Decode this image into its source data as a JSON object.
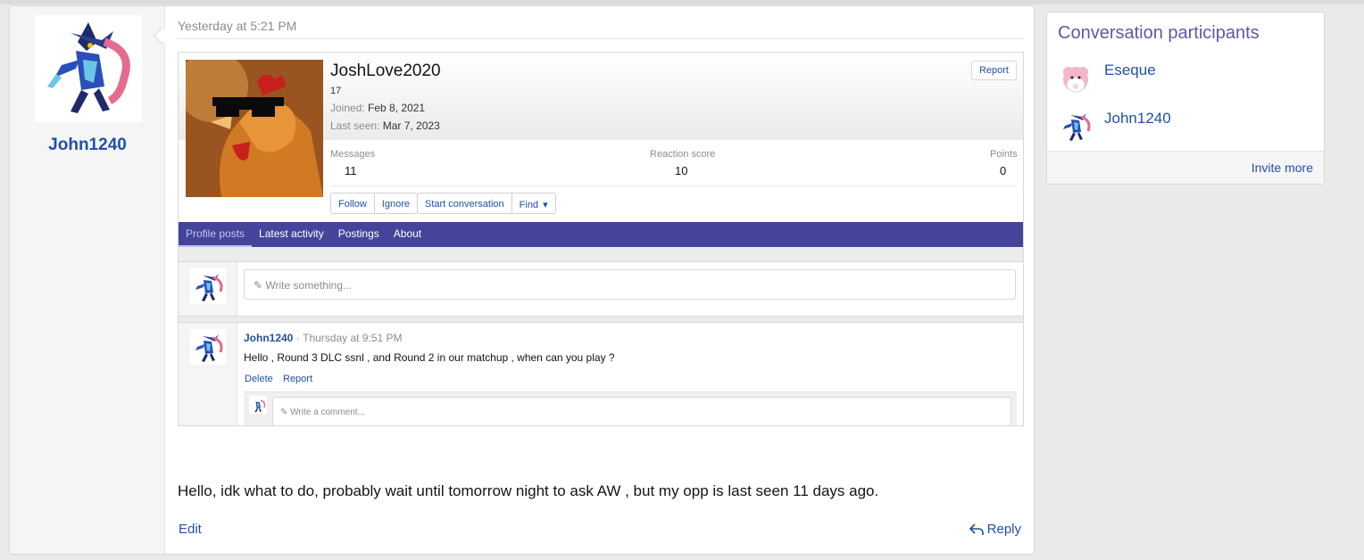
{
  "message": {
    "username": "John1240",
    "date": "Yesterday at 5:21 PM",
    "body": "Hello, idk what to do, probably wait until tomorrow night to ask AW , but my opp is last seen 11 days ago.",
    "edit_label": "Edit",
    "reply_label": "Reply"
  },
  "profile": {
    "name": "JoshLove2020",
    "age": "17",
    "joined_label": "Joined:",
    "joined_value": "Feb 8, 2021",
    "seen_label": "Last seen:",
    "seen_value": "Mar 7, 2023",
    "report_label": "Report",
    "stats": [
      {
        "label": "Messages",
        "value": "11"
      },
      {
        "label": "Reaction score",
        "value": "10"
      },
      {
        "label": "Points",
        "value": "0"
      }
    ],
    "buttons": {
      "follow": "Follow",
      "ignore": "Ignore",
      "start": "Start conversation",
      "find": "Find"
    },
    "tabs": [
      "Profile posts",
      "Latest activity",
      "Postings",
      "About"
    ],
    "write_placeholder": "Write something...",
    "post": {
      "user": "John1240",
      "time": "· Thursday at 9:51 PM",
      "text": "Hello , Round 3 DLC ssnl , and Round 2 in our matchup , when can you play ?",
      "delete_label": "Delete",
      "report_label": "Report",
      "comment_placeholder": "Write a comment..."
    }
  },
  "sidebar": {
    "title": "Conversation participants",
    "participants": [
      "Eseque",
      "John1240"
    ],
    "invite_label": "Invite more"
  },
  "icons": {
    "pencil": "pencil-icon",
    "reply": "reply-icon",
    "caret": "caret-down-icon"
  },
  "colors": {
    "link": "#2150a8",
    "tabbar": "#44449a",
    "sidebar_title": "#5a5aa8"
  }
}
